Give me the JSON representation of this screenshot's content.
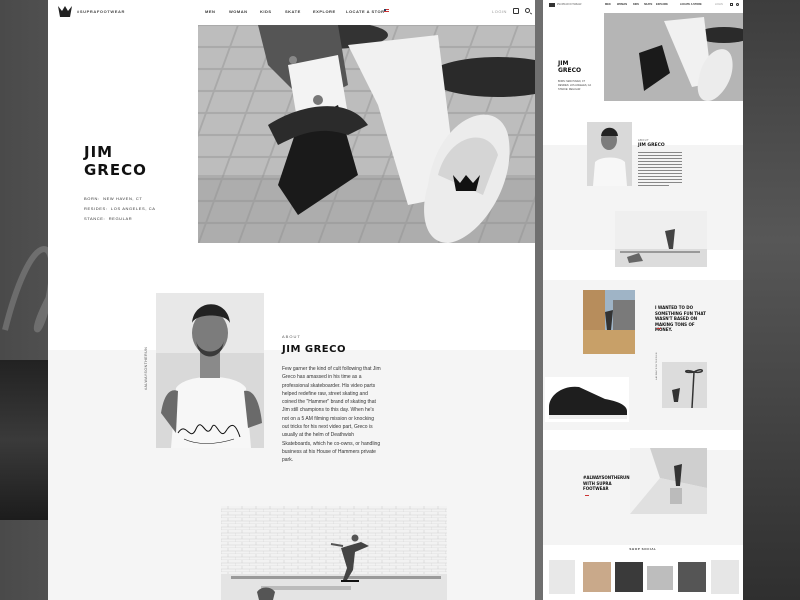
{
  "brand": {
    "handle": "#SUPRAFOOTWEAR"
  },
  "nav": {
    "items": [
      "MEN",
      "WOMAN",
      "KIDS",
      "SKATE",
      "EXPLORE",
      "LOCATE A STORE"
    ],
    "login": "LOGIN"
  },
  "hero": {
    "title_line1": "JIM",
    "title_line2": "GRECO",
    "info": [
      {
        "label": "BORN:",
        "value": "NEW HAVEN, CT"
      },
      {
        "label": "RESIDES:",
        "value": "LOS ANGELES, CA"
      },
      {
        "label": "STANCE:",
        "value": "REGULAR"
      }
    ]
  },
  "about": {
    "label": "ABOUT",
    "title": "JIM GRECO",
    "tag": "#ALWAYSONTHERUN",
    "body": "Few garner the kind of cult following that Jim Greco has amassed in his time as a professional skateboarder. His video parts helped redefine raw, street skating and coined the \"Hammer\" brand of skating that Jim still champions to this day. When he's not on a 5 AM filming mission or knocking out tricks for his next video part, Greco is usually at the helm of Deathwish Skateboards, which he co-owns, or handling business at his House of Hammers private park."
  },
  "page2": {
    "title_line1": "JIM",
    "title_line2": "GRECO",
    "info_lines": [
      "BORN: NEW HAVEN, CT",
      "RESIDES: LOS ANGELES, CA",
      "STANCE: REGULAR"
    ],
    "about_label": "ABOUT",
    "about_title": "JIM GRECO",
    "quote": "I WANTED TO DO SOMETHING FUN THAT WASN'T BASED ON MAKING TONS OF MONEY.",
    "hashtag": "#ALWAYSONTHERUN WITH SUPRA FOOTWEAR",
    "shop_social": "SHOP SOCIAL"
  },
  "colors": {
    "accent": "#cc3333",
    "text": "#111111",
    "band": "#f5f5f5"
  }
}
